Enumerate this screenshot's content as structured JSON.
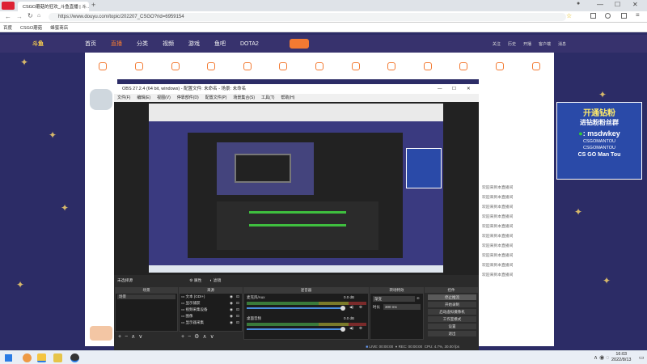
{
  "browser": {
    "tab_title": "CSGO蘑菇的狂欢_斗鱼直播 | 斗…",
    "url": "https://www.douyu.com/topic/202207_CSGO?rid=6959154",
    "bookmarks": [
      "百度",
      "CSGO蘑菇",
      "蜂蜜商店"
    ]
  },
  "site": {
    "nav": [
      "首页",
      "直播",
      "分类",
      "视频",
      "游戏",
      "鱼吧",
      "DOTA2"
    ],
    "icon_row_count": 13,
    "user_icons": [
      "关注",
      "历史",
      "开播",
      "客户端",
      "消息"
    ],
    "accent": "#f37a32",
    "chat_line": "欢迎来到本直播间"
  },
  "ad": {
    "line1": "开通钻粉",
    "line2": "进钻粉粉丝群",
    "wechat": ": msdwkey",
    "douyin": "CSGOMANTOU",
    "weibo": "CSGOMANTOU",
    "brand": "CS GO Man Tou"
  },
  "obs": {
    "title": "OBS 27.2.4 (64 bit, windows) - 配置文件: 未命名 - 场景: 未命名",
    "menu": [
      "文件(F)",
      "编辑(E)",
      "视图(V)",
      "停靠部件(D)",
      "配置文件(P)",
      "场景集合(S)",
      "工具(T)",
      "帮助(H)"
    ],
    "source_bar": [
      "未选择源",
      "属性",
      "滤镜"
    ],
    "pane_titles": {
      "scenes": "场景",
      "sources": "来源",
      "mixer": "混音器",
      "transitions": "转场特效",
      "controls": "控件"
    },
    "scene_items": [
      "场景"
    ],
    "source_items": [
      "文本 (GDI+)",
      "显示捕获",
      "视频采集设备",
      "图像",
      "显示器采集"
    ],
    "mixer_tracks": [
      {
        "name": "麦克风/Aux",
        "level": "0.0 dB"
      },
      {
        "name": "桌面音频",
        "level": "0.0 dB"
      }
    ],
    "transition": {
      "type": "渐变",
      "duration_label": "时长",
      "duration": "300 ms"
    },
    "controls": [
      "停止推流",
      "开始录制",
      "启动虚拟摄像机",
      "工作室模式",
      "设置",
      "退出"
    ],
    "status": {
      "live_label": "LIVE:",
      "live_time": "00:00:00",
      "rec_label": "REC:",
      "rec_time": "00:00:00",
      "cpu": "CPU: 4.7%, 30.00 fps"
    }
  },
  "taskbar": {
    "time": "16:03",
    "date": "2022/8/13"
  }
}
